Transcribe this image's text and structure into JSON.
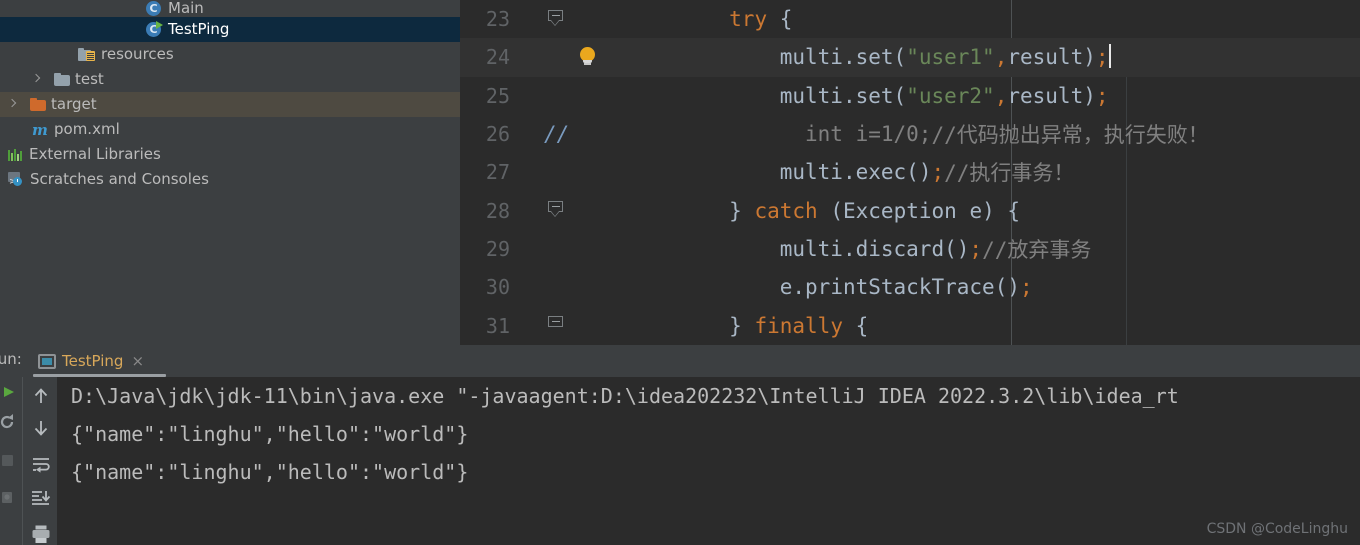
{
  "project_tree": {
    "items": [
      {
        "label": "Main",
        "icon": "java-class-icon",
        "indent": 146,
        "state": "partial-top",
        "arrow": false
      },
      {
        "label": "TestPing",
        "icon": "java-class-runnable-icon",
        "indent": 146,
        "state": "selected",
        "arrow": false
      },
      {
        "label": "resources",
        "icon": "resources-folder-icon",
        "indent": 78,
        "state": "normal",
        "arrow": false
      },
      {
        "label": "test",
        "icon": "folder-icon",
        "indent": 56,
        "state": "normal",
        "arrow": true
      },
      {
        "label": "target",
        "icon": "folder-orange-icon",
        "indent": 32,
        "state": "hover",
        "arrow": true
      },
      {
        "label": "pom.xml",
        "icon": "maven-icon",
        "indent": 32,
        "state": "normal",
        "arrow": false
      },
      {
        "label": "External Libraries",
        "icon": "external-libraries-icon",
        "indent": 8,
        "state": "normal",
        "arrow": false
      },
      {
        "label": "Scratches and Consoles",
        "icon": "scratches-icon",
        "indent": 8,
        "state": "normal",
        "arrow": false
      }
    ]
  },
  "editor": {
    "lines": [
      {
        "number": "23",
        "fold": "pointed",
        "bulb": false,
        "caret_line": false,
        "indent": "        ",
        "tokens": [
          {
            "t": "try",
            "c": "kw"
          },
          {
            "t": " ",
            "c": "plain"
          },
          {
            "t": "{",
            "c": "plain"
          }
        ]
      },
      {
        "number": "24",
        "fold": "none",
        "bulb": true,
        "caret_line": true,
        "indent": "            ",
        "tokens": [
          {
            "t": "multi",
            "c": "id"
          },
          {
            "t": ".",
            "c": "plain"
          },
          {
            "t": "set",
            "c": "id"
          },
          {
            "t": "(",
            "c": "plain"
          },
          {
            "t": "\"user1\"",
            "c": "str"
          },
          {
            "t": ",",
            "c": "pn"
          },
          {
            "t": "result",
            "c": "id"
          },
          {
            "t": ")",
            "c": "plain"
          },
          {
            "t": ";",
            "c": "pn"
          }
        ],
        "caret": true
      },
      {
        "number": "25",
        "fold": "none",
        "bulb": false,
        "caret_line": false,
        "indent": "            ",
        "tokens": [
          {
            "t": "multi",
            "c": "id"
          },
          {
            "t": ".",
            "c": "plain"
          },
          {
            "t": "set",
            "c": "id"
          },
          {
            "t": "(",
            "c": "plain"
          },
          {
            "t": "\"user2\"",
            "c": "str"
          },
          {
            "t": ",",
            "c": "pn"
          },
          {
            "t": "result",
            "c": "id"
          },
          {
            "t": ")",
            "c": "plain"
          },
          {
            "t": ";",
            "c": "pn"
          }
        ]
      },
      {
        "number": "26",
        "fold": "none",
        "bulb": false,
        "caret_line": false,
        "commented_gutter": "//",
        "indent": "              ",
        "tokens": [
          {
            "t": "int i=1/0;",
            "c": "cm"
          },
          {
            "t": "//代码抛出异常，执行失败！",
            "c": "cm"
          }
        ]
      },
      {
        "number": "27",
        "fold": "none",
        "bulb": false,
        "caret_line": false,
        "indent": "            ",
        "tokens": [
          {
            "t": "multi",
            "c": "id"
          },
          {
            "t": ".",
            "c": "plain"
          },
          {
            "t": "exec",
            "c": "id"
          },
          {
            "t": "(",
            "c": "plain"
          },
          {
            "t": ")",
            "c": "plain"
          },
          {
            "t": ";",
            "c": "pn"
          },
          {
            "t": "//执行事务！",
            "c": "cm"
          }
        ]
      },
      {
        "number": "28",
        "fold": "pointed",
        "bulb": false,
        "caret_line": false,
        "indent": "        ",
        "tokens": [
          {
            "t": "}",
            "c": "plain"
          },
          {
            "t": " ",
            "c": "plain"
          },
          {
            "t": "catch",
            "c": "kw"
          },
          {
            "t": " ",
            "c": "plain"
          },
          {
            "t": "(",
            "c": "plain"
          },
          {
            "t": "Exception",
            "c": "id"
          },
          {
            "t": " ",
            "c": "plain"
          },
          {
            "t": "e",
            "c": "id"
          },
          {
            "t": ")",
            "c": "plain"
          },
          {
            "t": " ",
            "c": "plain"
          },
          {
            "t": "{",
            "c": "plain"
          }
        ]
      },
      {
        "number": "29",
        "fold": "none",
        "bulb": false,
        "caret_line": false,
        "indent": "            ",
        "tokens": [
          {
            "t": "multi",
            "c": "id"
          },
          {
            "t": ".",
            "c": "plain"
          },
          {
            "t": "discard",
            "c": "id"
          },
          {
            "t": "(",
            "c": "plain"
          },
          {
            "t": ")",
            "c": "plain"
          },
          {
            "t": ";",
            "c": "pn"
          },
          {
            "t": "//放弃事务",
            "c": "cm"
          }
        ]
      },
      {
        "number": "30",
        "fold": "none",
        "bulb": false,
        "caret_line": false,
        "indent": "            ",
        "tokens": [
          {
            "t": "e",
            "c": "id"
          },
          {
            "t": ".",
            "c": "plain"
          },
          {
            "t": "printStackTrace",
            "c": "id"
          },
          {
            "t": "(",
            "c": "plain"
          },
          {
            "t": ")",
            "c": "plain"
          },
          {
            "t": ";",
            "c": "pn"
          }
        ]
      },
      {
        "number": "31",
        "fold": "flat",
        "bulb": false,
        "caret_line": false,
        "indent": "        ",
        "tokens": [
          {
            "t": "}",
            "c": "plain"
          },
          {
            "t": " ",
            "c": "plain"
          },
          {
            "t": "finally",
            "c": "kw"
          },
          {
            "t": " ",
            "c": "plain"
          },
          {
            "t": "{",
            "c": "plain"
          }
        ]
      }
    ]
  },
  "run_panel": {
    "label": "Run:",
    "tab_label": "TestPing",
    "close_glyph": "×",
    "toolbar": [
      {
        "name": "up-arrow-icon"
      },
      {
        "name": "down-arrow-icon"
      },
      {
        "name": "soft-wrap-icon"
      },
      {
        "name": "scroll-to-end-icon"
      },
      {
        "name": "print-icon"
      }
    ],
    "console_lines": [
      "D:\\Java\\jdk\\jdk-11\\bin\\java.exe \"-javaagent:D:\\idea202232\\IntelliJ IDEA 2022.3.2\\lib\\idea_rt",
      "{\"name\":\"linghu\",\"hello\":\"world\"}",
      "{\"name\":\"linghu\",\"hello\":\"world\"}"
    ]
  },
  "watermark": "CSDN @CodeLinghu",
  "colors": {
    "editor_bg": "#2b2b2b",
    "panel_bg": "#3c3f41",
    "selection_blue": "#0d293e",
    "hover_brown": "#4e4a41",
    "keyword_orange": "#cc7832",
    "string_green": "#6a8759",
    "identifier": "#a9b7c6",
    "comment_gray": "#808080",
    "tab_orange": "#d8a85a"
  }
}
